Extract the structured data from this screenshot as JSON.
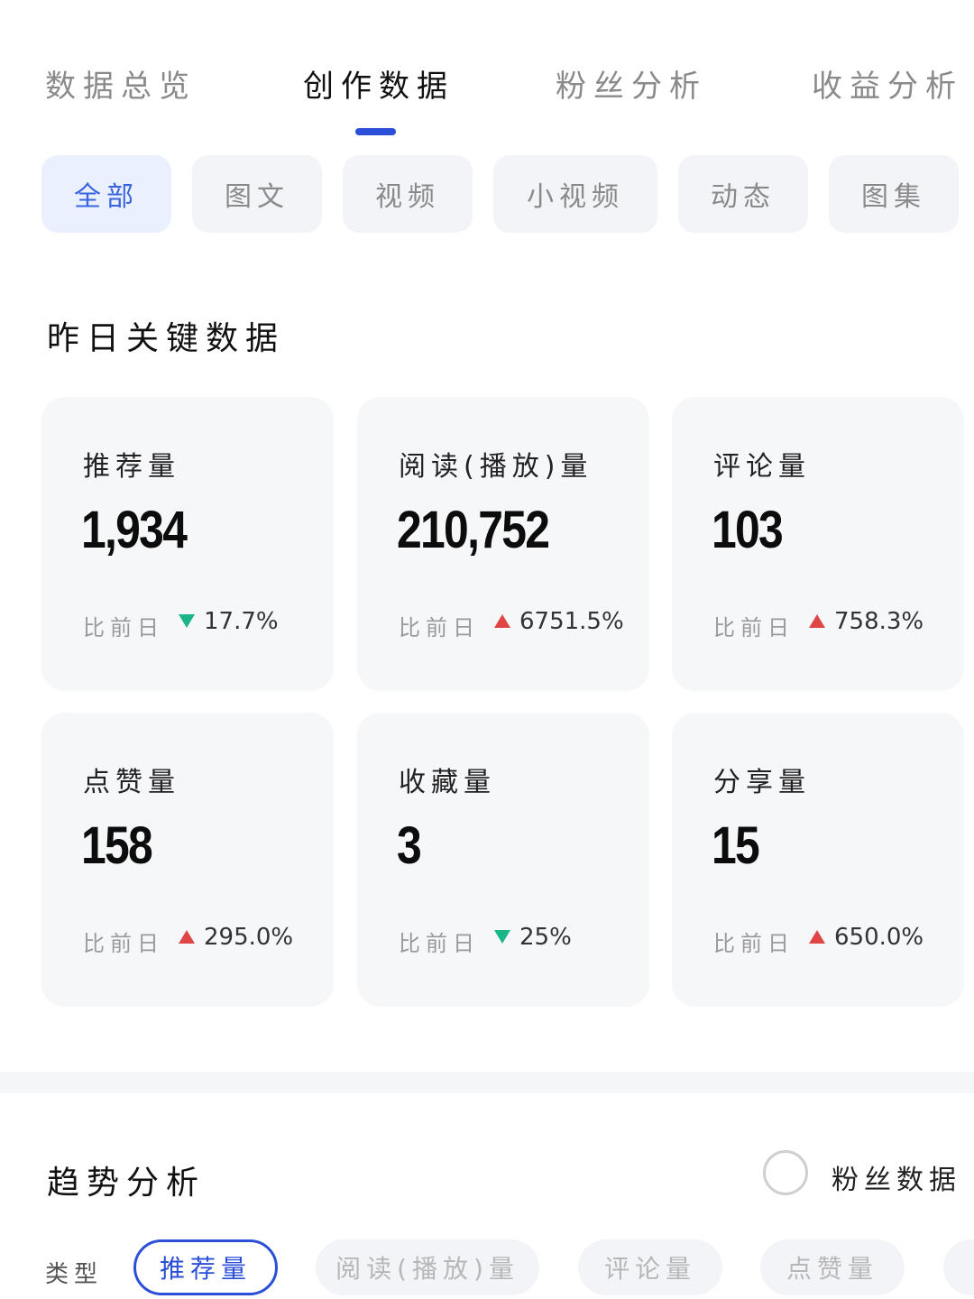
{
  "tabs": [
    {
      "label": "数据总览",
      "active": false
    },
    {
      "label": "创作数据",
      "active": true
    },
    {
      "label": "粉丝分析",
      "active": false
    },
    {
      "label": "收益分析",
      "active": false
    }
  ],
  "content_types": [
    {
      "label": "全部",
      "active": true
    },
    {
      "label": "图文",
      "active": false
    },
    {
      "label": "视频",
      "active": false
    },
    {
      "label": "小视频",
      "active": false
    },
    {
      "label": "动态",
      "active": false
    },
    {
      "label": "图集",
      "active": false
    }
  ],
  "key_data": {
    "title": "昨日关键数据",
    "compare_label": "比前日",
    "cards": [
      {
        "label": "推荐量",
        "value": "1,934",
        "trend": "down",
        "change": "17.7%"
      },
      {
        "label": "阅读(播放)量",
        "value": "210,752",
        "trend": "up",
        "change": "6751.5%"
      },
      {
        "label": "评论量",
        "value": "103",
        "trend": "up",
        "change": "758.3%"
      },
      {
        "label": "点赞量",
        "value": "158",
        "trend": "up",
        "change": "295.0%"
      },
      {
        "label": "收藏量",
        "value": "3",
        "trend": "down",
        "change": "25%"
      },
      {
        "label": "分享量",
        "value": "15",
        "trend": "up",
        "change": "650.0%"
      }
    ]
  },
  "trend": {
    "title": "趋势分析",
    "fans_toggle_label": "粉丝数据",
    "fans_toggle_checked": false,
    "type_label": "类型",
    "metrics": [
      {
        "label": "推荐量",
        "active": true
      },
      {
        "label": "阅读(播放)量",
        "active": false
      },
      {
        "label": "评论量",
        "active": false
      },
      {
        "label": "点赞量",
        "active": false
      }
    ]
  },
  "colors": {
    "accent": "#2b4fd6",
    "up": "#e04545",
    "down": "#1bb58a"
  }
}
